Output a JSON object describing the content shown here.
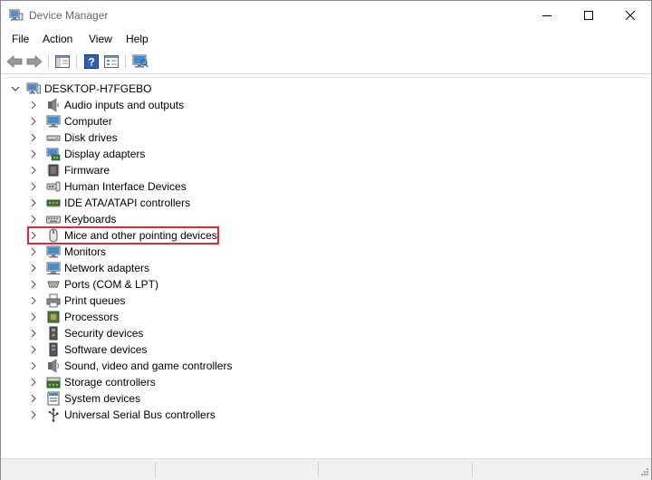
{
  "window": {
    "title": "Device Manager"
  },
  "menu": [
    "File",
    "Action",
    "View",
    "Help"
  ],
  "toolbar": [
    {
      "icon": "back-arrow-icon"
    },
    {
      "icon": "forward-arrow-icon"
    },
    {
      "icon": "show-hide-console-tree-icon"
    },
    {
      "icon": "help-icon"
    },
    {
      "icon": "properties-icon"
    },
    {
      "icon": "scan-hardware-changes-icon"
    }
  ],
  "tree": {
    "root": "DESKTOP-H7FGEBO",
    "items": [
      {
        "label": "Audio inputs and outputs",
        "icon": "speaker-icon"
      },
      {
        "label": "Computer",
        "icon": "computer-icon"
      },
      {
        "label": "Disk drives",
        "icon": "disk-drive-icon"
      },
      {
        "label": "Display adapters",
        "icon": "display-adapter-icon"
      },
      {
        "label": "Firmware",
        "icon": "firmware-chip-icon"
      },
      {
        "label": "Human Interface Devices",
        "icon": "hid-icon"
      },
      {
        "label": "IDE ATA/ATAPI controllers",
        "icon": "ide-controller-icon"
      },
      {
        "label": "Keyboards",
        "icon": "keyboard-icon"
      },
      {
        "label": "Mice and other pointing devices",
        "icon": "mouse-icon",
        "highlighted": true
      },
      {
        "label": "Monitors",
        "icon": "monitor-icon"
      },
      {
        "label": "Network adapters",
        "icon": "network-adapter-icon"
      },
      {
        "label": "Ports (COM & LPT)",
        "icon": "port-icon"
      },
      {
        "label": "Print queues",
        "icon": "printer-icon"
      },
      {
        "label": "Processors",
        "icon": "processor-icon"
      },
      {
        "label": "Security devices",
        "icon": "security-device-icon"
      },
      {
        "label": "Software devices",
        "icon": "software-device-icon"
      },
      {
        "label": "Sound, video and game controllers",
        "icon": "sound-controller-icon"
      },
      {
        "label": "Storage controllers",
        "icon": "storage-controller-icon"
      },
      {
        "label": "System devices",
        "icon": "system-devices-icon"
      },
      {
        "label": "Universal Serial Bus controllers",
        "icon": "usb-icon"
      }
    ]
  },
  "colors": {
    "highlight_border": "#e0282c",
    "accent_blue": "#1e73d2"
  }
}
